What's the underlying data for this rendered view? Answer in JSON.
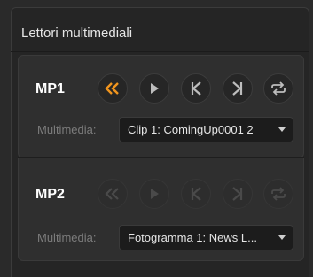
{
  "panel": {
    "title": "Lettori multimediali"
  },
  "players": [
    {
      "label": "MP1",
      "field_label": "Multimedia:",
      "selected": "Clip 1: ComingUp0001 2",
      "controls": [
        "rewind-icon",
        "play-icon",
        "previous-icon",
        "next-icon",
        "loop-icon"
      ],
      "active_control": "rewind-icon",
      "enabled": true
    },
    {
      "label": "MP2",
      "field_label": "Multimedia:",
      "selected": "Fotogramma 1: News L...",
      "controls": [
        "rewind-icon",
        "play-icon",
        "previous-icon",
        "next-icon",
        "loop-icon"
      ],
      "enabled": false
    }
  ],
  "colors": {
    "accent": "#f0951e",
    "icon": "#bdbdbd",
    "icon_dim": "#4a4a4a"
  }
}
